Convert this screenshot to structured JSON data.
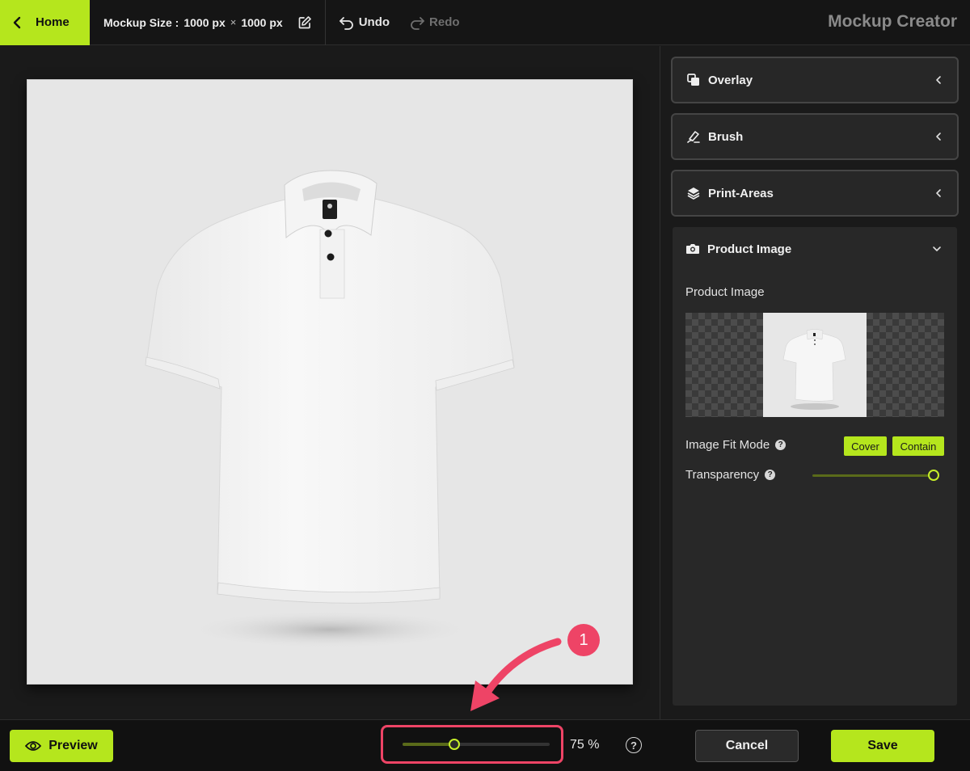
{
  "header": {
    "home_label": "Home",
    "mockup_size_label": "Mockup Size :",
    "width": "1000 px",
    "times": "×",
    "height": "1000 px",
    "undo_label": "Undo",
    "redo_label": "Redo",
    "app_title": "Mockup Creator"
  },
  "panel": {
    "sections": [
      {
        "label": "Overlay",
        "icon": "overlay-icon"
      },
      {
        "label": "Brush",
        "icon": "brush-icon"
      },
      {
        "label": "Print-Areas",
        "icon": "layers-icon"
      }
    ],
    "product": {
      "title": "Product Image",
      "icon": "camera-icon",
      "image_label": "Product Image",
      "fit_mode_label": "Image Fit Mode",
      "fit_cover": "Cover",
      "fit_contain": "Contain",
      "transparency_label": "Transparency",
      "transparency_value": 1.0
    }
  },
  "footer": {
    "preview_label": "Preview",
    "zoom_value": 0.35,
    "zoom_text": "75 %",
    "cancel_label": "Cancel",
    "save_label": "Save"
  },
  "annotation": {
    "badge": "1"
  },
  "colors": {
    "accent": "#b5e61d",
    "annotation": "#ee4466",
    "background": "#1a1a1a",
    "panel": "#282828"
  }
}
